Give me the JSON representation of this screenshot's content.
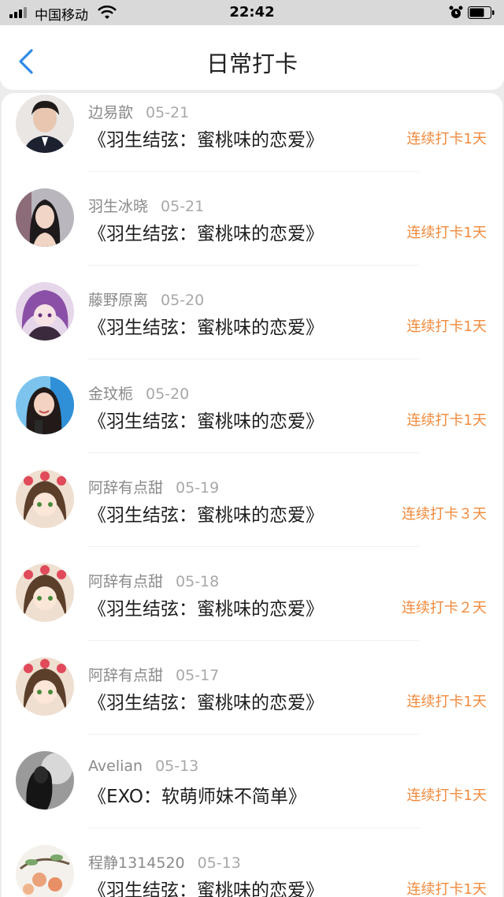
{
  "status_bar": {
    "carrier": "中国移动",
    "time": "22:42"
  },
  "nav": {
    "title": "日常打卡"
  },
  "checkins": [
    {
      "user": "边易歆",
      "date": "05-21",
      "book": "《羽生结弦：蜜桃味的恋爱》",
      "streak": "连续打卡1天",
      "avatar": "photo-portrait-male"
    },
    {
      "user": "羽生冰晓",
      "date": "05-21",
      "book": "《羽生结弦：蜜桃味的恋爱》",
      "streak": "连续打卡1天",
      "avatar": "photo-portrait-female"
    },
    {
      "user": "藤野原离",
      "date": "05-20",
      "book": "《羽生结弦：蜜桃味的恋爱》",
      "streak": "连续打卡1天",
      "avatar": "anime-purple-hair"
    },
    {
      "user": "金玟栀",
      "date": "05-20",
      "book": "《羽生结弦：蜜桃味的恋爱》",
      "streak": "连续打卡1天",
      "avatar": "photo-portrait-female-blue"
    },
    {
      "user": "阿辞有点甜",
      "date": "05-19",
      "book": "《羽生结弦：蜜桃味的恋爱》",
      "streak": "连续打卡３天",
      "avatar": "anime-girl-hearts"
    },
    {
      "user": "阿辞有点甜",
      "date": "05-18",
      "book": "《羽生结弦：蜜桃味的恋爱》",
      "streak": "连续打卡２天",
      "avatar": "anime-girl-hearts"
    },
    {
      "user": "阿辞有点甜",
      "date": "05-17",
      "book": "《羽生结弦：蜜桃味的恋爱》",
      "streak": "连续打卡1天",
      "avatar": "anime-girl-hearts"
    },
    {
      "user": "Avelian",
      "date": "05-13",
      "book": "《EXO：软萌师妹不简单》",
      "streak": "连续打卡1天",
      "avatar": "silhouette-grayscale"
    },
    {
      "user": "程静1314520",
      "date": "05-13",
      "book": "《羽生结弦：蜜桃味的恋爱》",
      "streak": "连续打卡1天",
      "avatar": "fruit-branch-illustration"
    }
  ]
}
